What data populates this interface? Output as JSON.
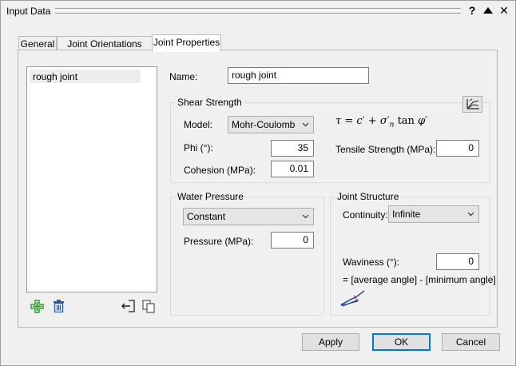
{
  "window": {
    "title": "Input Data",
    "help_label": "?",
    "close_label": "✕"
  },
  "tabs": [
    {
      "label": "General"
    },
    {
      "label": "Joint Orientations"
    },
    {
      "label": "Joint Properties"
    }
  ],
  "joint_list": {
    "items": [
      {
        "label": "rough joint"
      }
    ]
  },
  "name_field": {
    "label": "Name:",
    "value": "rough joint"
  },
  "shear_strength": {
    "title": "Shear Strength",
    "model_label": "Model:",
    "model_value": "Mohr-Coulomb",
    "phi_label": "Phi (°):",
    "phi_value": "35",
    "cohesion_label": "Cohesion (MPa):",
    "cohesion_value": "0.01",
    "tensile_label": "Tensile Strength (MPa):",
    "tensile_value": "0",
    "formula": {
      "tau": "τ",
      "eq": "=",
      "c": "c′",
      "plus": "+",
      "sigma": "σ′",
      "sub_n": "n",
      "tan": "tan",
      "phi": "φ′"
    }
  },
  "water_pressure": {
    "title": "Water Pressure",
    "type_value": "Constant",
    "pressure_label": "Pressure (MPa):",
    "pressure_value": "0"
  },
  "joint_structure": {
    "title": "Joint Structure",
    "continuity_label": "Continuity:",
    "continuity_value": "Infinite",
    "waviness_label": "Waviness (°):",
    "waviness_value": "0",
    "waviness_note": "= [average angle] - [minimum angle]"
  },
  "buttons": {
    "apply": "Apply",
    "ok": "OK",
    "cancel": "Cancel"
  },
  "colors": {
    "add_icon": "#2e9a2e",
    "delete_icon": "#1f5fa8",
    "default_border": "#0078d7"
  }
}
